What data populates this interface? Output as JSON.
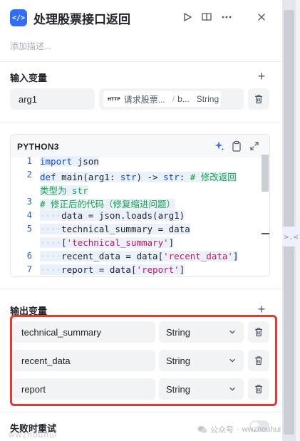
{
  "header": {
    "title": "处理股票接口返回",
    "app_icon_text": "</>",
    "icons": [
      "code-icon",
      "play-icon",
      "book-open-icon",
      "more-horizontal-icon",
      "close-icon"
    ]
  },
  "description_placeholder": "添加描述...",
  "input_section": {
    "title": "输入变量",
    "add_icon": "+",
    "variables": [
      {
        "name": "arg1",
        "ref_tag": "HTTP",
        "ref_source": "请求股票...",
        "ref_separator": "/",
        "ref_field": "b...",
        "ref_type": "String"
      }
    ]
  },
  "code_section": {
    "language": "PYTHON3",
    "icons": [
      "sparkle-icon",
      "clipboard-icon",
      "expand-icon"
    ],
    "lines": [
      {
        "num": "1",
        "segments": [
          {
            "t": "kw",
            "v": "import"
          },
          {
            "t": "plain",
            "v": " json"
          }
        ]
      },
      {
        "num": "2",
        "segments": [
          {
            "t": "kw",
            "v": "def"
          },
          {
            "t": "plain",
            "v": " main(arg1: "
          },
          {
            "t": "kw",
            "v": "str"
          },
          {
            "t": "plain",
            "v": ") -> "
          },
          {
            "t": "kw",
            "v": "str"
          },
          {
            "t": "plain",
            "v": ": "
          },
          {
            "t": "cm",
            "v": "# 修改返回"
          }
        ]
      },
      {
        "num": "",
        "segments": [
          {
            "t": "cm",
            "v": "类型为 str"
          }
        ]
      },
      {
        "num": "3",
        "segments": [
          {
            "t": "cm",
            "v": "# 修正后的代码（修复缩进问题）"
          }
        ]
      },
      {
        "num": "4",
        "segments": [
          {
            "t": "ws",
            "v": "····"
          },
          {
            "t": "plain",
            "v": "data = json.loads(arg1)"
          }
        ]
      },
      {
        "num": "5",
        "segments": [
          {
            "t": "ws",
            "v": "····"
          },
          {
            "t": "plain",
            "v": "technical_summary = data"
          }
        ]
      },
      {
        "num": "",
        "segments": [
          {
            "t": "ws",
            "v": "····"
          },
          {
            "t": "plain",
            "v": "["
          },
          {
            "t": "str",
            "v": "'technical_summary'"
          },
          {
            "t": "plain",
            "v": "]"
          }
        ]
      },
      {
        "num": "6",
        "segments": [
          {
            "t": "ws",
            "v": "····"
          },
          {
            "t": "plain",
            "v": "recent_data = data["
          },
          {
            "t": "str",
            "v": "'recent_data'"
          },
          {
            "t": "plain",
            "v": "]"
          }
        ]
      },
      {
        "num": "7",
        "segments": [
          {
            "t": "ws",
            "v": "····"
          },
          {
            "t": "plain",
            "v": "report = data["
          },
          {
            "t": "str",
            "v": "'report'"
          },
          {
            "t": "plain",
            "v": "]"
          }
        ]
      }
    ]
  },
  "output_section": {
    "title": "输出变量",
    "add_icon": "+",
    "variables": [
      {
        "name": "technical_summary",
        "type": "String"
      },
      {
        "name": "recent_data",
        "type": "String"
      },
      {
        "name": "report",
        "type": "String"
      }
    ]
  },
  "retry_section": {
    "title": "失败时重试"
  },
  "watermark": {
    "left": "wwzhouhui",
    "right_label": "公众号",
    "right_separator": "·",
    "right_name": "wwzhouhui"
  },
  "edge_handle": ">.<",
  "colors": {
    "accent": "#336df4",
    "highlight_border": "#e53935",
    "field_bg": "#f2f3f5",
    "keyword": "#0b45d6",
    "comment": "#16a34a",
    "string": "#c2185b"
  }
}
